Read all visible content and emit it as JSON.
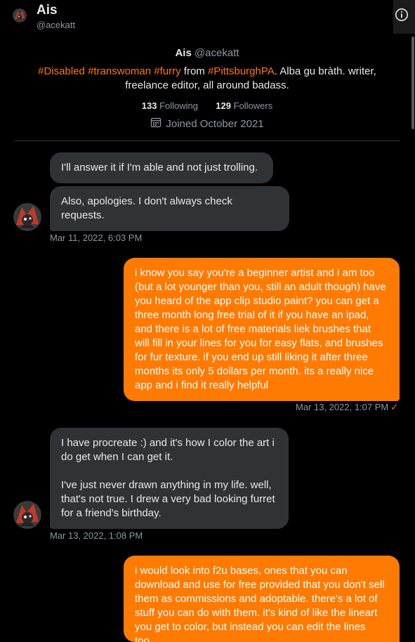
{
  "header": {
    "name": "Ais",
    "handle": "@acekatt",
    "info_icon": "info-icon"
  },
  "profile": {
    "name": "Ais",
    "handle": "@acekatt",
    "bio_tags": [
      "#Disabled",
      "#transwoman",
      "#furry"
    ],
    "bio_from": " from ",
    "bio_location": "#PittsburghPA",
    "bio_rest": ". Alba gu bràth. writer,",
    "bio_line2": "freelance editor, all around badass.",
    "following_count": "133",
    "following_label": "Following",
    "followers_count": "129",
    "followers_label": "Followers",
    "joined": "Joined October 2021",
    "calendar_icon": "calendar-icon"
  },
  "messages": [
    {
      "direction": "in",
      "text": "I'll answer it if I'm able and not just trolling."
    },
    {
      "direction": "in",
      "text": "Also, apologies. I don't always check\nrequests."
    },
    {
      "timestamp": "Mar 11, 2022, 6:03 PM"
    },
    {
      "direction": "out",
      "text": "i know you say you're a beginner artist and i am too\n(but a lot younger than you, still an adult though) have\nyou heard of the app clip studio paint? you can get a\nthree month long free trial of it if you have an ipad,\nand there is a lot of free materials liek brushes that\nwill fill in your lines for you for easy flats, and brushes\nfor fur texture. if you end up still liking it after three\nmonths its only 5 dollars per month. its a really nice\napp and i find it really helpful"
    },
    {
      "timestamp": "Mar 13, 2022, 1:07 PM",
      "status": "✓"
    },
    {
      "direction": "in",
      "text": "I have procreate :) and it's how I color the art i\ndo get when I can get it.\n\nI've just never drawn anything in my life. well,\nthat's not true. I drew a very bad looking furret\nfor a friend's birthday."
    },
    {
      "timestamp": "Mar 13, 2022, 1:08 PM"
    },
    {
      "direction": "out",
      "text": "i would look into f2u bases, ones that you can\ndownload and use for free provided that you don't sell\nthem as commissions and adoptable. there's a lot of\nstuff you can do with them. it's kind of like the lineart\nyou get to color, but instead you can edit the lines\ntoo"
    }
  ],
  "colors": {
    "accent": "#ff7a00",
    "incoming_bubble": "#2f3336",
    "background": "#000000",
    "muted_text": "#8b98a5"
  }
}
